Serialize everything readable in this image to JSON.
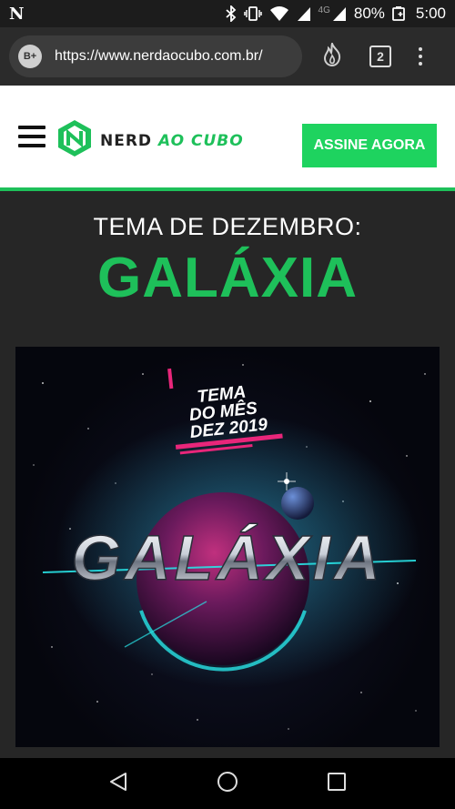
{
  "status_bar": {
    "app_notification_glyph": "N",
    "network_label": "4G",
    "battery_percent": "80%",
    "time": "5:00",
    "icons": [
      "bluetooth-icon",
      "vibrate-icon",
      "wifi-icon",
      "signal-icon",
      "signal-icon",
      "battery-charging-icon"
    ]
  },
  "browser": {
    "site_badge": "B+",
    "url": "https://www.nerdaocubo.com.br/",
    "tab_count": "2",
    "icons": [
      "flame-icon",
      "tab-switcher-icon",
      "more-vert-icon"
    ]
  },
  "header": {
    "logo_part1": "NERD",
    "logo_part2": "AO CUBO",
    "cta_label": "ASSINE AGORA",
    "icons": [
      "menu-icon",
      "cube-logo-icon"
    ]
  },
  "main": {
    "theme_label": "TEMA DE DEZEMBRO:",
    "theme_title": "GALÁXIA"
  },
  "banner": {
    "tag_line1": "TEMA",
    "tag_line2": "DO MÊS",
    "tag_line3": "DEZ 2019",
    "headline": "GALÁXIA"
  },
  "nav_bar": {
    "icons": [
      "back-icon",
      "home-icon",
      "recents-icon"
    ]
  },
  "colors": {
    "accent_green": "#1ec05a",
    "cta_green": "#1ed35f",
    "banner_pink": "#e8267a",
    "banner_cyan": "#29e3e6"
  }
}
